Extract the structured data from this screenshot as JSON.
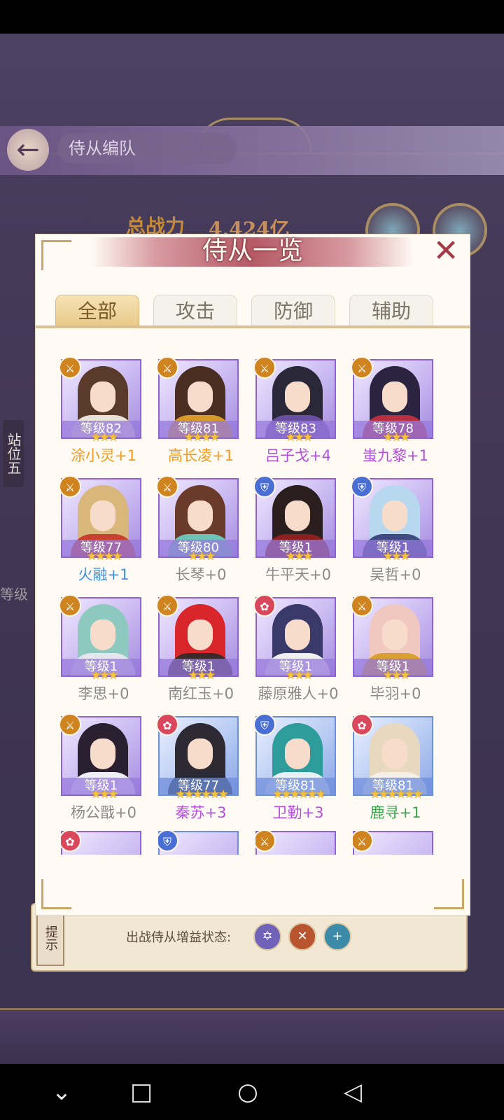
{
  "background": {
    "page_title": "侍从编队",
    "power_label": "总战力",
    "power_value": "4.424亿",
    "side_tag": "站位五",
    "level_text": "等级",
    "hint_label": "提示",
    "buff_label": "出战侍从增益状态:"
  },
  "modal": {
    "title": "侍从一览",
    "close_symbol": "✕",
    "tabs": [
      {
        "label": "全部",
        "active": true
      },
      {
        "label": "攻击",
        "active": false
      },
      {
        "label": "防御",
        "active": false
      },
      {
        "label": "辅助",
        "active": false
      }
    ]
  },
  "colors": {
    "orange_name": "#f39a1e",
    "purple_name": "#b34fe0",
    "blue_name": "#3c8fe8",
    "gray_name": "#8a8a8a",
    "green_name": "#3aa64c",
    "attack_icon": "#cf8420",
    "defense_icon": "#4a6fd4",
    "support_icon": "#d9475c"
  },
  "servants": [
    {
      "name": "涂小灵+1",
      "level": "等级82",
      "stars": 3,
      "type": "attack",
      "color": "orange",
      "frame": "purple",
      "hair": "#5a3a2a",
      "robe": "#e8e2d8"
    },
    {
      "name": "高长凌+1",
      "level": "等级81",
      "stars": 4,
      "type": "attack",
      "color": "orange",
      "frame": "purple",
      "hair": "#4a2e22",
      "robe": "#d89a2a"
    },
    {
      "name": "吕子戈+4",
      "level": "等级83",
      "stars": 3,
      "type": "attack",
      "color": "purple",
      "frame": "purple",
      "hair": "#2a2838",
      "robe": "#6a4fa0"
    },
    {
      "name": "蚩九黎+1",
      "level": "等级78",
      "stars": 3,
      "type": "attack",
      "color": "purple",
      "frame": "purple",
      "hair": "#2b2440",
      "robe": "#b83040"
    },
    {
      "name": "火融+1",
      "level": "等级77",
      "stars": 4,
      "type": "attack",
      "color": "blue",
      "frame": "purple",
      "hair": "#d9b77a",
      "robe": "#c84030"
    },
    {
      "name": "长琴+0",
      "level": "等级80",
      "stars": 3,
      "type": "attack",
      "color": "gray",
      "frame": "purple",
      "hair": "#6a3a2a",
      "robe": "#6fc2b8"
    },
    {
      "name": "牛平天+0",
      "level": "等级1",
      "stars": 3,
      "type": "defense",
      "color": "gray",
      "frame": "purple",
      "hair": "#2a1e1e",
      "robe": "#8a2020"
    },
    {
      "name": "吴哲+0",
      "level": "等级1",
      "stars": 3,
      "type": "defense",
      "color": "gray",
      "frame": "purple",
      "hair": "#b7d8ee",
      "robe": "#3e4a80"
    },
    {
      "name": "李思+0",
      "level": "等级1",
      "stars": 3,
      "type": "attack",
      "color": "gray",
      "frame": "purple",
      "hair": "#8ec9c0",
      "robe": "#e6e6ee"
    },
    {
      "name": "南红玉+0",
      "level": "等级1",
      "stars": 3,
      "type": "attack",
      "color": "gray",
      "frame": "purple",
      "hair": "#d8262a",
      "robe": "#3a2a2a"
    },
    {
      "name": "藤原雅人+0",
      "level": "等级1",
      "stars": 3,
      "type": "support",
      "color": "gray",
      "frame": "purple",
      "hair": "#3a3a6a",
      "robe": "#f0f0f0"
    },
    {
      "name": "毕羽+0",
      "level": "等级1",
      "stars": 3,
      "type": "attack",
      "color": "gray",
      "frame": "purple",
      "hair": "#f0c8c0",
      "robe": "#d8a030"
    },
    {
      "name": "杨公戬+0",
      "level": "等级1",
      "stars": 3,
      "type": "attack",
      "color": "gray",
      "frame": "purple",
      "hair": "#2a2030",
      "robe": "#eef0f6"
    },
    {
      "name": "秦苏+3",
      "level": "等级77",
      "stars": 6,
      "type": "support",
      "color": "purple",
      "frame": "blue",
      "hair": "#2e2a34",
      "robe": "#2a2a36"
    },
    {
      "name": "卫勤+3",
      "level": "等级81",
      "stars": 6,
      "type": "defense",
      "color": "purple",
      "frame": "blue",
      "hair": "#2f9c9c",
      "robe": "#e8f0f4"
    },
    {
      "name": "鹿寻+1",
      "level": "等级81",
      "stars": 6,
      "type": "support",
      "color": "green",
      "frame": "blue",
      "hair": "#e8d8c0",
      "robe": "#f4f0e8"
    }
  ],
  "peek_row": [
    {
      "type": "support"
    },
    {
      "type": "defense"
    },
    {
      "type": "attack"
    },
    {
      "type": "attack"
    }
  ],
  "icons": {
    "attack": "sword-icon",
    "defense": "shield-icon",
    "support": "lotus-icon",
    "nav_back": "triangle-back-icon",
    "nav_home": "circle-home-icon",
    "nav_recent": "square-recent-icon",
    "nav_down": "chevron-down-icon"
  },
  "nav": {
    "down": "⌄",
    "recent": "□",
    "home": "○",
    "back": "◁"
  }
}
